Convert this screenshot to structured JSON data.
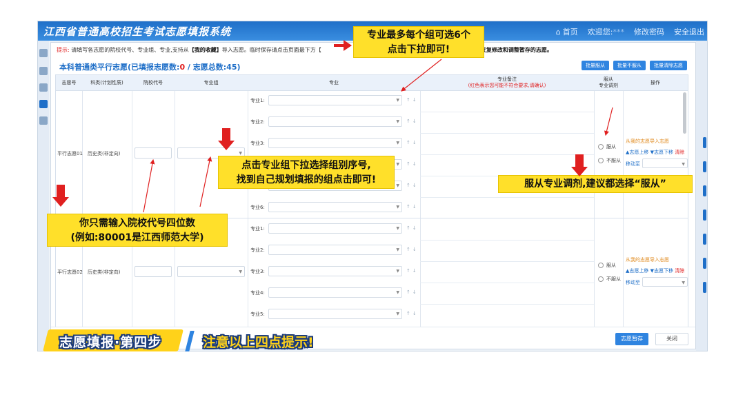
{
  "app": {
    "title": "江西省普通高校招生考试志愿填报系统",
    "nav": {
      "home": "首页",
      "welcome": "欢迎您:",
      "user_masked": "***",
      "change_password": "修改密码",
      "logout": "安全退出"
    }
  },
  "hint": {
    "prefix": "提示:",
    "text_a": "请填写各志愿的院校代号、专业组、专业,支持从",
    "favorites": "【我的收藏】",
    "text_b": "导入志愿。临时保存请点击页面最下方【",
    "text_c": "可以",
    "text_d": "反复修改和调整暂存的志愿。"
  },
  "section": {
    "title_a": "本科普通类平行志愿(已填报志愿数:",
    "filled_count": "0",
    "title_b": " / 志愿总数:",
    "total_count": "45",
    "title_c": ")"
  },
  "actions": [
    "批量服从",
    "批量不服从",
    "批量清除志愿"
  ],
  "columns": {
    "no": "志愿号",
    "subject": "科类(计划性质)",
    "school_code": "院校代号",
    "group": "专业组",
    "major": "专业",
    "note": "专业备注",
    "note_sub": "(红色表示您可能不符合要求,请确认)",
    "adjust": "服从\n专业调剂",
    "op": "操作"
  },
  "rows": [
    {
      "no": "平行志愿01",
      "subject": "历史类(非定向)",
      "majors": [
        "专业1:",
        "专业2:",
        "专业3:",
        "专业4:",
        "专业5:",
        "专业6:"
      ],
      "obey": "服从",
      "not_obey": "不服从",
      "import": "从我的志愿导入志愿",
      "move_up": "▲志愿上移",
      "move_down": "▼志愿下移",
      "clear": "清除",
      "move_to": "移动至"
    },
    {
      "no": "平行志愿02",
      "subject": "历史类(非定向)",
      "majors": [
        "专业1:",
        "专业2:",
        "专业3:",
        "专业4:",
        "专业5:"
      ],
      "obey": "服从",
      "not_obey": "不服从",
      "import": "从我的志愿导入志愿",
      "move_up": "▲志愿上移",
      "move_down": "▼志愿下移",
      "clear": "清除",
      "move_to": "移动至"
    }
  ],
  "footer": {
    "save": "志愿暂存",
    "close": "关闭"
  },
  "callouts": {
    "major_line1": "专业最多每个组可选6个",
    "major_line2": "点击下拉即可!",
    "group_line1": "点击专业组下拉选择组别序号,",
    "group_line2": "找到自己规划填报的组点击即可!",
    "code_line1": "你只需输入院校代号四位数",
    "code_line2": "(例如:80001是江西师范大学)",
    "adjust": "服从专业调剂,建议都选择“服从”"
  },
  "banner": {
    "step": "志愿填报·第四步",
    "note": "注意以上四点提示!"
  },
  "colors": {
    "accent": "#1f6fc8",
    "callout": "#ffe02a",
    "arrow": "#e02020"
  }
}
